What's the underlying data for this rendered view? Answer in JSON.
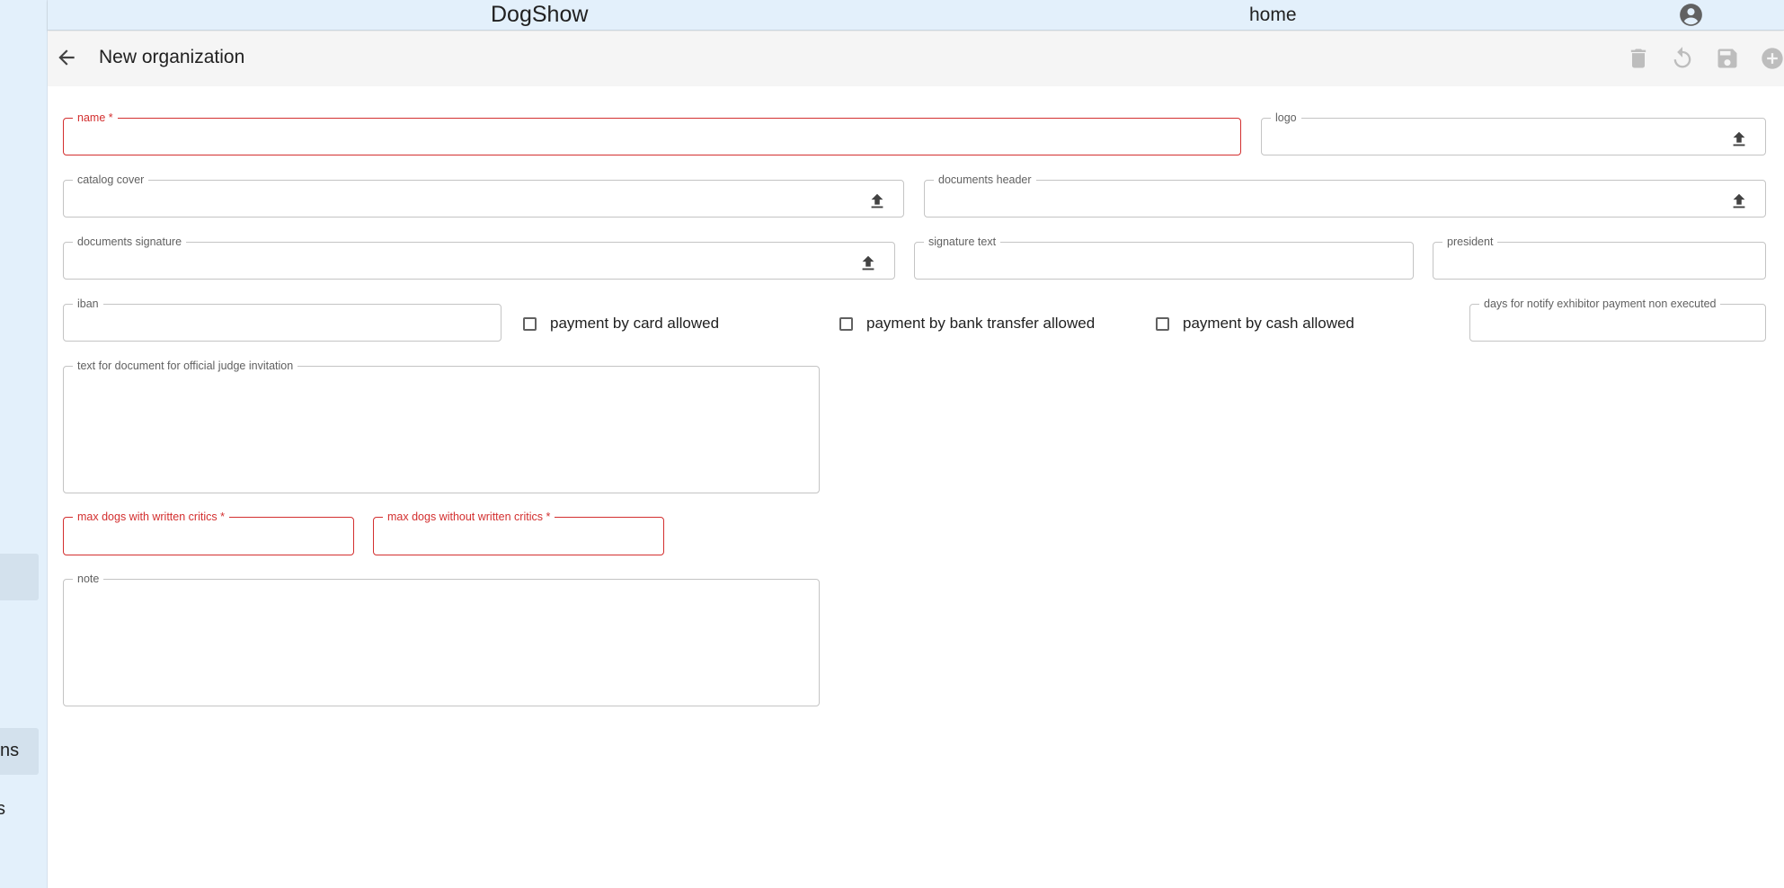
{
  "appbar": {
    "brand": "DogShow",
    "home": "home",
    "account_icon": "account-circle-icon"
  },
  "sidebar": {
    "items": [
      {
        "label": ""
      },
      {
        "label": "ns"
      },
      {
        "label": "s"
      }
    ]
  },
  "toolbar": {
    "title": "New organization",
    "back_icon": "arrow-back-icon",
    "actions": [
      "delete-icon",
      "undo-icon",
      "save-icon",
      "add-icon"
    ]
  },
  "form": {
    "name": {
      "label": "name *",
      "value": ""
    },
    "logo": {
      "label": "logo"
    },
    "catalog_cover": {
      "label": "catalog cover"
    },
    "documents_header": {
      "label": "documents header"
    },
    "documents_signature": {
      "label": "documents signature"
    },
    "signature_text": {
      "label": "signature text",
      "value": ""
    },
    "president": {
      "label": "president",
      "value": ""
    },
    "iban": {
      "label": "iban",
      "value": ""
    },
    "payment_card": {
      "label": "payment by card allowed",
      "checked": false
    },
    "payment_bank": {
      "label": "payment by bank transfer allowed",
      "checked": false
    },
    "payment_cash": {
      "label": "payment by cash allowed",
      "checked": false
    },
    "days_notify": {
      "label": "days for notify exhibitor payment non executed",
      "value": ""
    },
    "judge_text": {
      "label": "text for document for official judge invitation",
      "value": ""
    },
    "max_with": {
      "label": "max dogs with written critics *",
      "value": ""
    },
    "max_without": {
      "label": "max dogs without written critics *",
      "value": ""
    },
    "note": {
      "label": "note",
      "value": ""
    }
  },
  "colors": {
    "appbar_bg": "#e3f0fb",
    "toolbar_bg": "#f5f5f5",
    "error": "#d32f2f",
    "border": "#c4c4c4"
  }
}
